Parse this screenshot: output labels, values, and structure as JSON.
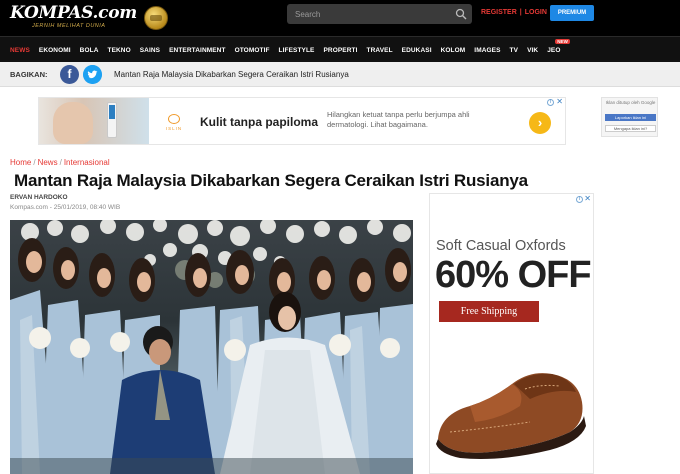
{
  "header": {
    "logo_text": "KOMPAS.com",
    "logo_tagline": "JERNIH MELIHAT DUNIA",
    "search_placeholder": "Search",
    "register_label": "REGISTER",
    "login_label": "LOGIN",
    "separator": "|",
    "premium_label": "PREMIUM"
  },
  "nav": {
    "items": [
      "NEWS",
      "EKONOMI",
      "BOLA",
      "TEKNO",
      "SAINS",
      "ENTERTAINMENT",
      "OTOMOTIF",
      "LIFESTYLE",
      "PROPERTI",
      "TRAVEL",
      "EDUKASI",
      "KOLOM",
      "IMAGES",
      "TV",
      "VIK",
      "JEO"
    ],
    "active": "NEWS",
    "new_badge": "NEW",
    "accent_color": "#e53935"
  },
  "share": {
    "label": "BAGIKAN:",
    "facebook_glyph": "f",
    "title": "Mantan Raja Malaysia Dikabarkan Segera Ceraikan Istri Rusianya"
  },
  "top_ad": {
    "brand": "ISLIN",
    "title": "Kulit tanpa papiloma",
    "description": "Hilangkan ketuat tanpa perlu berjumpa ahli dermatologi. Lihat bagaimana.",
    "arrow": "›",
    "info": "i",
    "close": "✕"
  },
  "side_small_ad": {
    "line1": "Iklan ditutup oleh Google",
    "button": "Laporkan iklan ini",
    "button2": "Mengapa iklan ini?"
  },
  "article": {
    "breadcrumb": [
      "Home",
      "News",
      "Internasional"
    ],
    "breadcrumb_sep": "/",
    "title": "Mantan Raja Malaysia Dikabarkan Segera Ceraikan Istri Rusianya",
    "author": "ERVAN HARDOKO",
    "dateline": "Kompas.com - 25/01/2019, 08:40 WIB"
  },
  "shoe_ad": {
    "headline": "Soft Casual Oxfords",
    "discount": "60% OFF",
    "shipping": "Free Shipping"
  }
}
